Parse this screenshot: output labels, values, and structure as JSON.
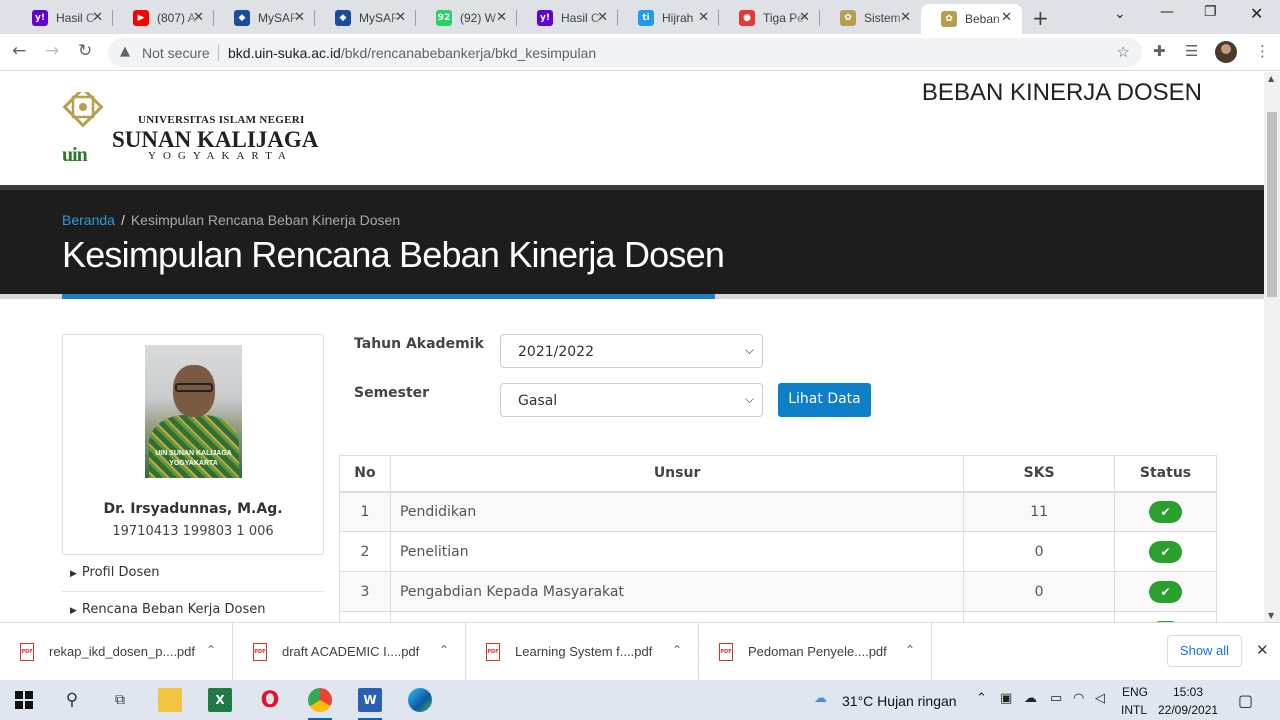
{
  "browser": {
    "tabs": [
      {
        "title": "Hasil C",
        "favicon": "yahoo-icon",
        "color": "#6001d2",
        "glyph": "y!"
      },
      {
        "title": "(807) A",
        "favicon": "youtube-icon",
        "color": "#ff0000",
        "glyph": "▶"
      },
      {
        "title": "MySAF",
        "favicon": "mysap-icon",
        "color": "#1a4e9c",
        "glyph": "◆"
      },
      {
        "title": "MySAF",
        "favicon": "mysap-icon",
        "color": "#1a4e9c",
        "glyph": "◆"
      },
      {
        "title": "(92) W",
        "favicon": "whatsapp-icon",
        "color": "#25d366",
        "glyph": "92"
      },
      {
        "title": "Hasil C",
        "favicon": "yahoo-icon",
        "color": "#6001d2",
        "glyph": "y!"
      },
      {
        "title": "Hijrah",
        "favicon": "ti-icon",
        "color": "#1d9bf0",
        "glyph": "ti"
      },
      {
        "title": "Tiga Pe",
        "favicon": "pin-icon",
        "color": "#e53935",
        "glyph": "●"
      },
      {
        "title": "Sistem",
        "favicon": "uin-icon",
        "color": "#b6a050",
        "glyph": "✿"
      },
      {
        "title": "Beban",
        "favicon": "uin-icon",
        "color": "#b6a050",
        "glyph": "✿"
      }
    ],
    "not_secure": "Not secure",
    "url_host": "bkd.uin-suka.ac.id",
    "url_path": "/bkd/rencanabebankerja/bkd_kesimpulan"
  },
  "header": {
    "logo_line1": "UNIVERSITAS ISLAM NEGERI",
    "logo_line2": "SUNAN KALIJAGA",
    "logo_line3": "YOGYAKARTA",
    "logo_mark": "uin",
    "site_title": "BEBAN KINERJA DOSEN"
  },
  "hero": {
    "breadcrumb_home": "Beranda",
    "breadcrumb_current": "Kesimpulan Rencana Beban Kinerja Dosen",
    "title": "Kesimpulan Rencana Beban Kinerja Dosen"
  },
  "profile": {
    "photo_watermark_1": "UIN SUNAN KALIJAGA",
    "photo_watermark_2": "YOGYAKARTA",
    "name": "Dr. Irsyadunnas, M.Ag.",
    "nip": "19710413 199803 1 006"
  },
  "sidenav": [
    "Profil Dosen",
    "Rencana Beban Kerja Dosen"
  ],
  "form": {
    "tahun_label": "Tahun Akademik",
    "tahun_value": "2021/2022",
    "semester_label": "Semester",
    "semester_value": "Gasal",
    "button": "Lihat Data"
  },
  "table": {
    "headers": [
      "No",
      "Unsur",
      "SKS",
      "Status"
    ],
    "rows": [
      {
        "no": "1",
        "unsur": "Pendidikan",
        "sks": "11",
        "status": "ok"
      },
      {
        "no": "2",
        "unsur": "Penelitian",
        "sks": "0",
        "status": "ok"
      },
      {
        "no": "3",
        "unsur": "Pengabdian Kepada Masyarakat",
        "sks": "0",
        "status": "ok"
      }
    ],
    "status_color": "#2ca02c"
  },
  "downloads": {
    "items": [
      "rekap_ikd_dosen_p....pdf",
      "draft ACADEMIC I....pdf",
      "Learning System f....pdf",
      "Pedoman Penyele....pdf"
    ],
    "show_all": "Show all"
  },
  "taskbar": {
    "weather": "31°C  Hujan ringan",
    "lang1": "ENG",
    "lang2": "INTL",
    "time": "15:03",
    "date": "22/09/2021"
  },
  "colors": {
    "accent_blue": "#0d7fc8",
    "hero_bg": "#1d1d1d",
    "link_blue": "#2e9be0"
  }
}
